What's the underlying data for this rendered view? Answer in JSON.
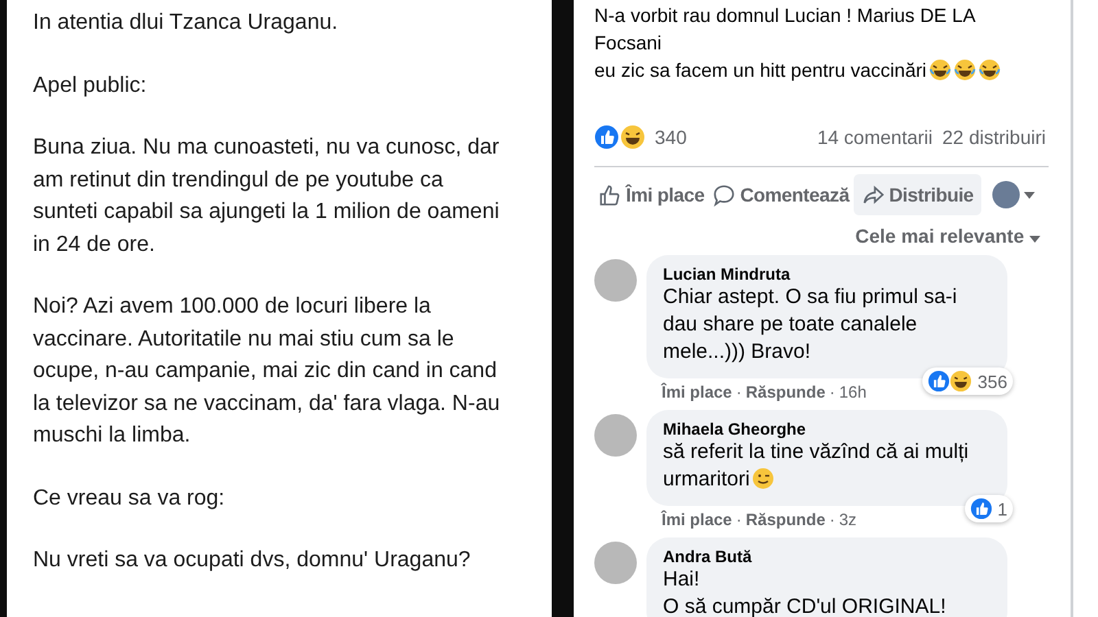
{
  "letter": {
    "paragraphs": [
      "In atentia dlui Tzanca Uraganu.",
      "Apel public:",
      "Buna ziua. Nu ma cunoasteti, nu va cunosc, dar am retinut din trendingul de pe youtube ca sunteti capabil sa ajungeti la 1 milion de oameni in 24 de ore.",
      "Noi? Azi avem 100.000 de locuri libere la vaccinare. Autoritatile nu mai stiu cum sa le ocupe, n-au campanie, mai zic din cand in cand la televizor sa ne vaccinam, da' fara vlaga. N-au muschi la limba.",
      "Ce vreau sa va rog:",
      "Nu vreti sa va ocupati dvs, domnu' Uraganu?"
    ]
  },
  "post": {
    "lines": [
      {
        "text": "N-a vorbit rau domnul Lucian ! Marius DE LA Focsani"
      },
      {
        "text": "eu zic sa facem un hitt pentru vaccinări",
        "emojis": [
          {
            "kind": "laugh"
          },
          {
            "kind": "laugh"
          },
          {
            "kind": "laugh"
          }
        ]
      }
    ],
    "reactions": [
      {
        "kind": "like"
      },
      {
        "kind": "haha"
      }
    ],
    "reaction_count": "340",
    "comments_count": "14 comentarii",
    "shares_count": "22 distribuiri",
    "actions": [
      {
        "kind": "like",
        "label": "Îmi place",
        "selected": false
      },
      {
        "kind": "comment",
        "label": "Comentează",
        "selected": false
      },
      {
        "kind": "share",
        "label": "Distribuie",
        "selected": true
      }
    ]
  },
  "sort": "Cele mai relevante",
  "comments": [
    {
      "author": "Lucian Mindruta",
      "text": "Chiar astept. O sa fiu primul sa-i dau share pe toate canalele mele...))) Bravo!",
      "reactions": [
        {
          "kind": "like"
        },
        {
          "kind": "haha"
        }
      ],
      "reaction_count": "356",
      "like": "Îmi place",
      "separator": "·",
      "reply": "Răspunde",
      "time": "16h"
    },
    {
      "author": "Mihaela Gheorghe",
      "text": "să referit la tine văzînd că ai mulți urmaritori",
      "emoji": {
        "kind": "wink"
      },
      "reactions": [
        {
          "kind": "like"
        }
      ],
      "reaction_count": "1",
      "like": "Îmi place",
      "separator": "·",
      "reply": "Răspunde",
      "time": "3z"
    },
    {
      "author": "Andra Bută",
      "text": "Hai!\nO să cumpăr CD'ul ORIGINAL!"
    }
  ]
}
